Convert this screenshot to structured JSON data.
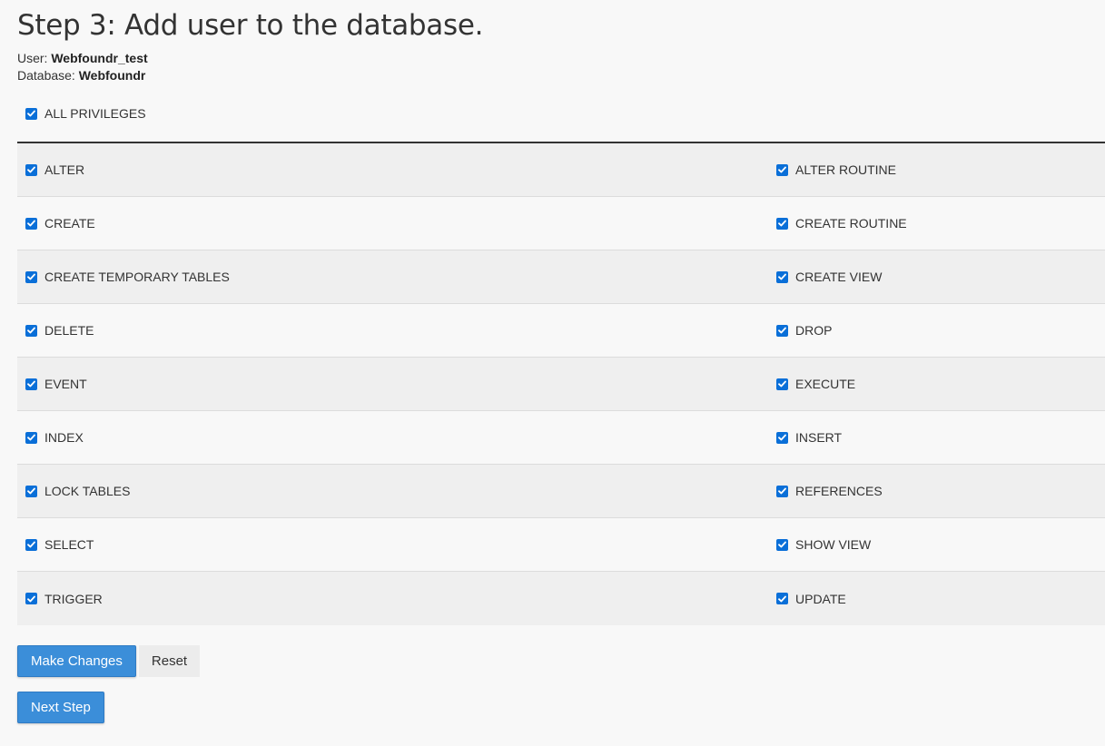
{
  "step": {
    "title": "Step 3: Add user to the database."
  },
  "meta": {
    "user_label": "User:",
    "user_value": "Webfoundr_test",
    "database_label": "Database:",
    "database_value": "Webfoundr"
  },
  "all_privileges": {
    "label": "ALL PRIVILEGES",
    "checked": true
  },
  "privileges": [
    {
      "left": "ALTER",
      "right": "ALTER ROUTINE"
    },
    {
      "left": "CREATE",
      "right": "CREATE ROUTINE"
    },
    {
      "left": "CREATE TEMPORARY TABLES",
      "right": "CREATE VIEW"
    },
    {
      "left": "DELETE",
      "right": "DROP"
    },
    {
      "left": "EVENT",
      "right": "EXECUTE"
    },
    {
      "left": "INDEX",
      "right": "INSERT"
    },
    {
      "left": "LOCK TABLES",
      "right": "REFERENCES"
    },
    {
      "left": "SELECT",
      "right": "SHOW VIEW"
    },
    {
      "left": "TRIGGER",
      "right": "UPDATE"
    }
  ],
  "buttons": {
    "make_changes": "Make Changes",
    "reset": "Reset",
    "next_step": "Next Step"
  },
  "colors": {
    "primary": "#3b8ed9",
    "checkbox": "#0a6fd8"
  }
}
